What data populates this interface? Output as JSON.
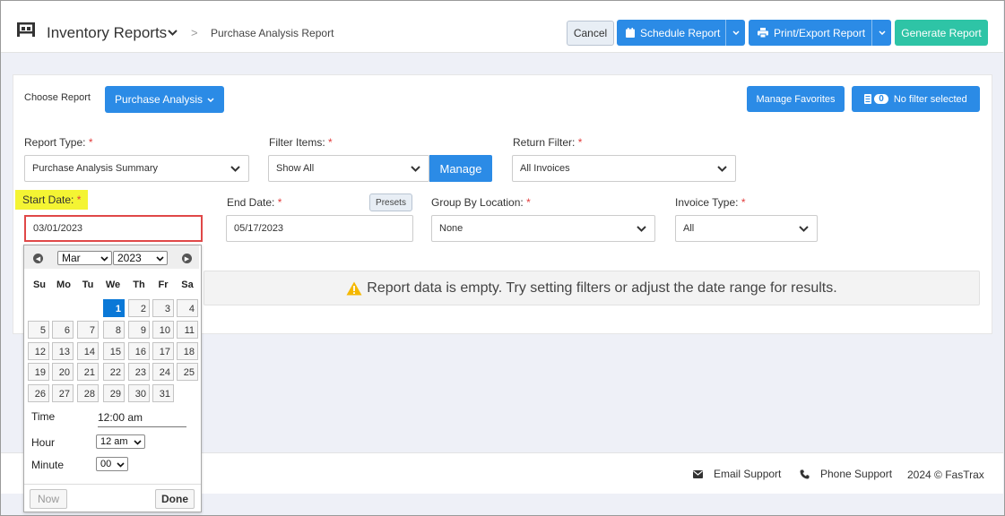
{
  "header": {
    "title": "Inventory Reports",
    "breadcrumb_sep": ">",
    "breadcrumb": "Purchase Analysis Report",
    "cancel_label": "Cancel",
    "schedule_label": "Schedule Report",
    "print_label": "Print/Export Report",
    "generate_label": "Generate Report"
  },
  "toolbar": {
    "choose_label": "Choose Report",
    "choose_value": "Purchase Analysis",
    "favorites_label": "Manage Favorites",
    "filter_count": "0",
    "filter_label": "No filter selected"
  },
  "form": {
    "report_type_label": "Report Type:",
    "report_type_value": "Purchase Analysis Summary",
    "filter_items_label": "Filter Items:",
    "filter_items_value": "Show All",
    "manage_label": "Manage",
    "return_filter_label": "Return Filter:",
    "return_filter_value": "All Invoices",
    "start_date_label": "Start Date:",
    "start_date_value": "03/01/2023",
    "end_date_label": "End Date:",
    "end_date_value": "05/17/2023",
    "presets_label": "Presets",
    "group_by_label": "Group By Location:",
    "group_by_value": "None",
    "invoice_type_label": "Invoice Type:",
    "invoice_type_value": "All",
    "required_mark": "*"
  },
  "notice": {
    "text": "Report data is empty. Try setting filters or adjust the date range for results."
  },
  "datepicker": {
    "month": "Mar",
    "year": "2023",
    "weekdays": [
      "Su",
      "Mo",
      "Tu",
      "We",
      "Th",
      "Fr",
      "Sa"
    ],
    "days": [
      "1",
      "2",
      "3",
      "4",
      "5",
      "6",
      "7",
      "8",
      "9",
      "10",
      "11",
      "12",
      "13",
      "14",
      "15",
      "16",
      "17",
      "18",
      "19",
      "20",
      "21",
      "22",
      "23",
      "24",
      "25",
      "26",
      "27",
      "28",
      "29",
      "30",
      "31"
    ],
    "selected_day": "1",
    "time_label": "Time",
    "time_value": "12:00 am",
    "hour_label": "Hour",
    "hour_value": "12 am",
    "minute_label": "Minute",
    "minute_value": "00",
    "now_label": "Now",
    "done_label": "Done"
  },
  "footer": {
    "email_label": "Email Support",
    "phone_label": "Phone Support",
    "copyright": "2024 © FasTrax"
  },
  "colors": {
    "primary": "#2b8be6",
    "accent_green": "#2ec4a6",
    "required": "#e23b3b",
    "highlight": "#f4f433",
    "focus_border": "#e04848",
    "selected_day": "#0a78d7"
  }
}
